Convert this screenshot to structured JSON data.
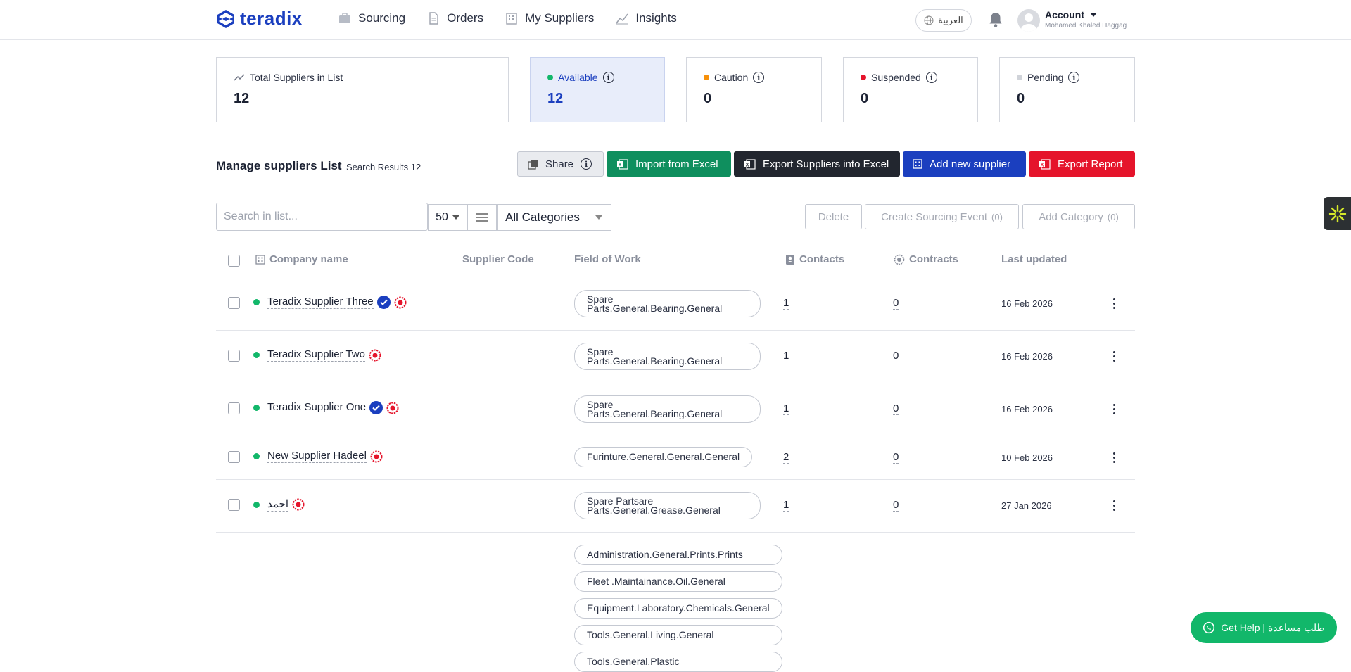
{
  "brand": {
    "name": "teradix",
    "accent": "#1b3fbf"
  },
  "nav": {
    "sourcing": "Sourcing",
    "orders": "Orders",
    "my_suppliers": "My Suppliers",
    "insights": "Insights"
  },
  "header": {
    "language": "العربية",
    "account_label": "Account",
    "account_user": "Mohamed Khaled Haggag"
  },
  "stats": {
    "total": {
      "label": "Total Suppliers in List",
      "value": "12"
    },
    "available": {
      "label": "Available",
      "value": "12",
      "color": "#12b76a"
    },
    "caution": {
      "label": "Caution",
      "value": "0",
      "color": "#f79009"
    },
    "suspended": {
      "label": "Suspended",
      "value": "0",
      "color": "#e5142b"
    },
    "pending": {
      "label": "Pending",
      "value": "0",
      "color": "#d0d3d9"
    }
  },
  "manage": {
    "title": "Manage suppliers List",
    "results": "Search Results 12"
  },
  "actions": {
    "share": "Share",
    "import": "Import from Excel",
    "export": "Export Suppliers into Excel",
    "add": "Add new supplier",
    "report": "Export Report"
  },
  "filters": {
    "search_placeholder": "Search in list...",
    "per_page": "50",
    "category": "All Categories",
    "delete": "Delete",
    "create_event": "Create Sourcing Event",
    "create_event_count": "(0)",
    "add_category": "Add Category",
    "add_category_count": "(0)"
  },
  "table": {
    "headers": {
      "company": "Company name",
      "code": "Supplier Code",
      "field": "Field of Work",
      "contacts": "Contacts",
      "contracts": "Contracts",
      "updated": "Last updated"
    },
    "rows": [
      {
        "name": "Teradix Supplier Three",
        "verified": true,
        "field": [
          "Spare",
          "Parts.General.Bearing.General"
        ],
        "contacts": "1",
        "contracts": "0",
        "updated": "16 Feb 2026"
      },
      {
        "name": "Teradix Supplier Two",
        "verified": false,
        "field": [
          "Spare",
          "Parts.General.Bearing.General"
        ],
        "contacts": "1",
        "contracts": "0",
        "updated": "16 Feb 2026"
      },
      {
        "name": "Teradix Supplier One",
        "verified": true,
        "field": [
          "Spare",
          "Parts.General.Bearing.General"
        ],
        "contacts": "1",
        "contracts": "0",
        "updated": "16 Feb 2026"
      },
      {
        "name": "New Supplier Hadeel",
        "verified": false,
        "field": [
          "Furinture.General.General.General"
        ],
        "contacts": "2",
        "contracts": "0",
        "updated": "10 Feb 2026"
      },
      {
        "name": "احمد",
        "verified": false,
        "field": [
          "Spare Partsare",
          "Parts.General.Grease.General"
        ],
        "contacts": "1",
        "contracts": "0",
        "updated": "27 Jan 2026"
      }
    ],
    "extra_fields": [
      "Administration.General.Prints.Prints",
      "Fleet .Maintainance.Oil.General",
      "Equipment.Laboratory.Chemicals.General",
      "Tools.General.Living.General",
      "Tools.General.Plastic"
    ]
  },
  "help": {
    "label": "Get Help | طلب مساعدة"
  }
}
